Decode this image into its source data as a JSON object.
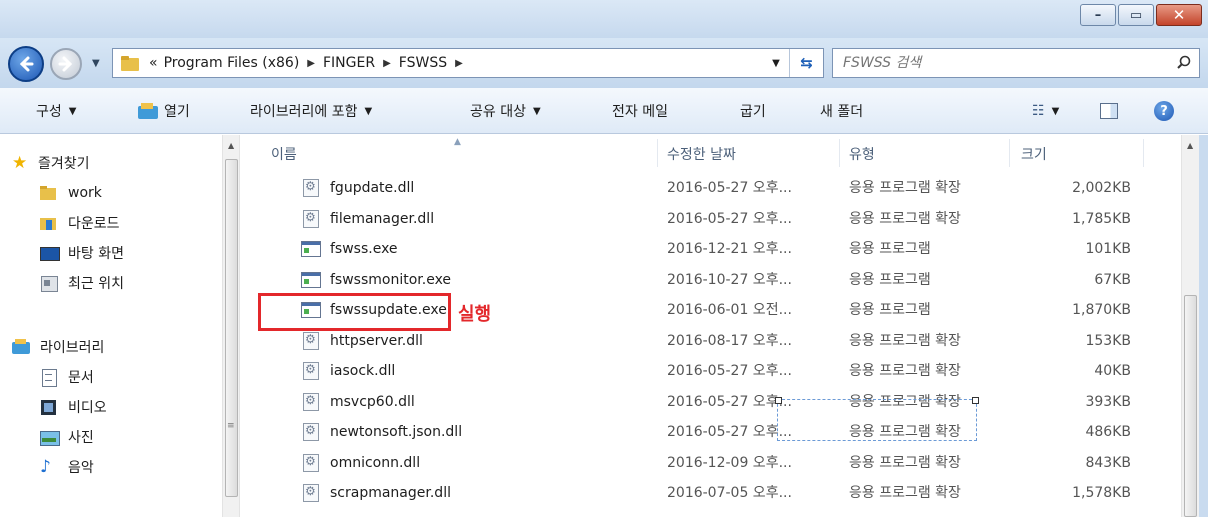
{
  "window": {
    "minimize_label": "–",
    "maximize_label": "▭",
    "close_label": "✕"
  },
  "address": {
    "crumbs": [
      "Program Files (x86)",
      "FINGER",
      "FSWSS"
    ],
    "overflow": "«",
    "search_placeholder": "FSWSS 검색"
  },
  "toolbar": {
    "organize": "구성",
    "open": "열기",
    "include_library": "라이브러리에 포함",
    "share_with": "공유 대상",
    "email": "전자 메일",
    "burn": "굽기",
    "new_folder": "새 폴더"
  },
  "nav": {
    "favorites": "즐겨찾기",
    "work": "work",
    "downloads": "다운로드",
    "desktop": "바탕 화면",
    "recent": "최근 위치",
    "libraries": "라이브러리",
    "documents": "문서",
    "videos": "비디오",
    "pictures": "사진",
    "music": "음악"
  },
  "columns": {
    "name": "이름",
    "date": "수정한 날짜",
    "type": "유형",
    "size": "크기"
  },
  "files": [
    {
      "name": "fgupdate.dll",
      "date": "2016-05-27 오후...",
      "type": "응용 프로그램 확장",
      "size": "2,002KB",
      "icon": "dll"
    },
    {
      "name": "filemanager.dll",
      "date": "2016-05-27 오후...",
      "type": "응용 프로그램 확장",
      "size": "1,785KB",
      "icon": "dll"
    },
    {
      "name": "fswss.exe",
      "date": "2016-12-21 오후...",
      "type": "응용 프로그램",
      "size": "101KB",
      "icon": "exe"
    },
    {
      "name": "fswssmonitor.exe",
      "date": "2016-10-27 오후...",
      "type": "응용 프로그램",
      "size": "67KB",
      "icon": "exe"
    },
    {
      "name": "fswssupdate.exe",
      "date": "2016-06-01 오전...",
      "type": "응용 프로그램",
      "size": "1,870KB",
      "icon": "exe"
    },
    {
      "name": "httpserver.dll",
      "date": "2016-08-17 오후...",
      "type": "응용 프로그램 확장",
      "size": "153KB",
      "icon": "dll"
    },
    {
      "name": "iasock.dll",
      "date": "2016-05-27 오후...",
      "type": "응용 프로그램 확장",
      "size": "40KB",
      "icon": "dll"
    },
    {
      "name": "msvcp60.dll",
      "date": "2016-05-27 오후...",
      "type": "응용 프로그램 확장",
      "size": "393KB",
      "icon": "dll"
    },
    {
      "name": "newtonsoft.json.dll",
      "date": "2016-05-27 오후...",
      "type": "응용 프로그램 확장",
      "size": "486KB",
      "icon": "dll"
    },
    {
      "name": "omniconn.dll",
      "date": "2016-12-09 오후...",
      "type": "응용 프로그램 확장",
      "size": "843KB",
      "icon": "dll"
    },
    {
      "name": "scrapmanager.dll",
      "date": "2016-07-05 오후...",
      "type": "응용 프로그램 확장",
      "size": "1,578KB",
      "icon": "dll"
    }
  ],
  "annotation": {
    "label": "실행",
    "color": "#e3282b"
  },
  "colors": {
    "accent": "#1d57b4",
    "highlight_red": "#e3282b"
  }
}
